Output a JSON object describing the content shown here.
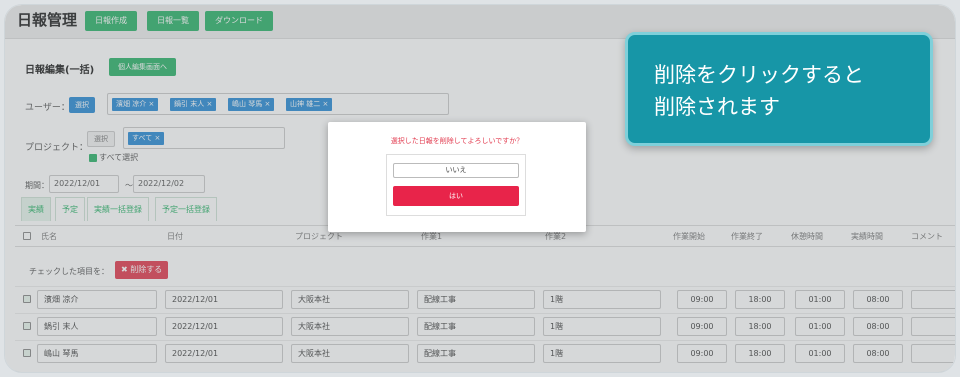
{
  "header": {
    "title": "日報管理",
    "nav": [
      "日報作成",
      "日報一覧",
      "ダウンロード"
    ]
  },
  "section": {
    "title": "日報編集(一括)",
    "individual_button": "個人編集画面へ"
  },
  "user_filter": {
    "label": "ユーザー：",
    "select_button": "選択",
    "tags": [
      "濱畑 凉介",
      "鍋引 末人",
      "嶋山 琴馬",
      "山神 雄二"
    ]
  },
  "project_filter": {
    "label": "プロジェクト：",
    "select_button": "選択",
    "tags": [
      "すべて"
    ],
    "select_all_label": "すべて選択"
  },
  "period": {
    "label": "期間：",
    "from": "2022/12/01",
    "separator": "〜",
    "to": "2022/12/02"
  },
  "tabs": [
    "実績",
    "予定",
    "実績一括登録",
    "予定一括登録"
  ],
  "table": {
    "columns": [
      "氏名",
      "日付",
      "プロジェクト",
      "作業1",
      "作業2",
      "作業開始",
      "作業終了",
      "休憩時間",
      "実績時間",
      "コメント"
    ],
    "bulk_label": "チェックした項目を：",
    "delete_button": "削除する",
    "rows": [
      {
        "name": "濱畑 凉介",
        "date": "2022/12/01",
        "project": "大阪本社",
        "work1": "配線工事",
        "work2": "1階",
        "start": "09:00",
        "end": "18:00",
        "break": "01:00",
        "actual": "08:00"
      },
      {
        "name": "鍋引 末人",
        "date": "2022/12/01",
        "project": "大阪本社",
        "work1": "配線工事",
        "work2": "1階",
        "start": "09:00",
        "end": "18:00",
        "break": "01:00",
        "actual": "08:00"
      },
      {
        "name": "嶋山 琴馬",
        "date": "2022/12/01",
        "project": "大阪本社",
        "work1": "配線工事",
        "work2": "1階",
        "start": "09:00",
        "end": "18:00",
        "break": "01:00",
        "actual": "08:00"
      }
    ]
  },
  "modal": {
    "message": "選択した日報を削除してよろしいですか？",
    "no_button": "いいえ",
    "yes_button": "はい"
  },
  "callout": {
    "text": "削除をクリックすると\n削除されます"
  },
  "colors": {
    "accent_green": "#2db46a",
    "tag_blue": "#2a8bd6",
    "danger_red": "#e8244a",
    "callout_teal": "#1796a7"
  }
}
